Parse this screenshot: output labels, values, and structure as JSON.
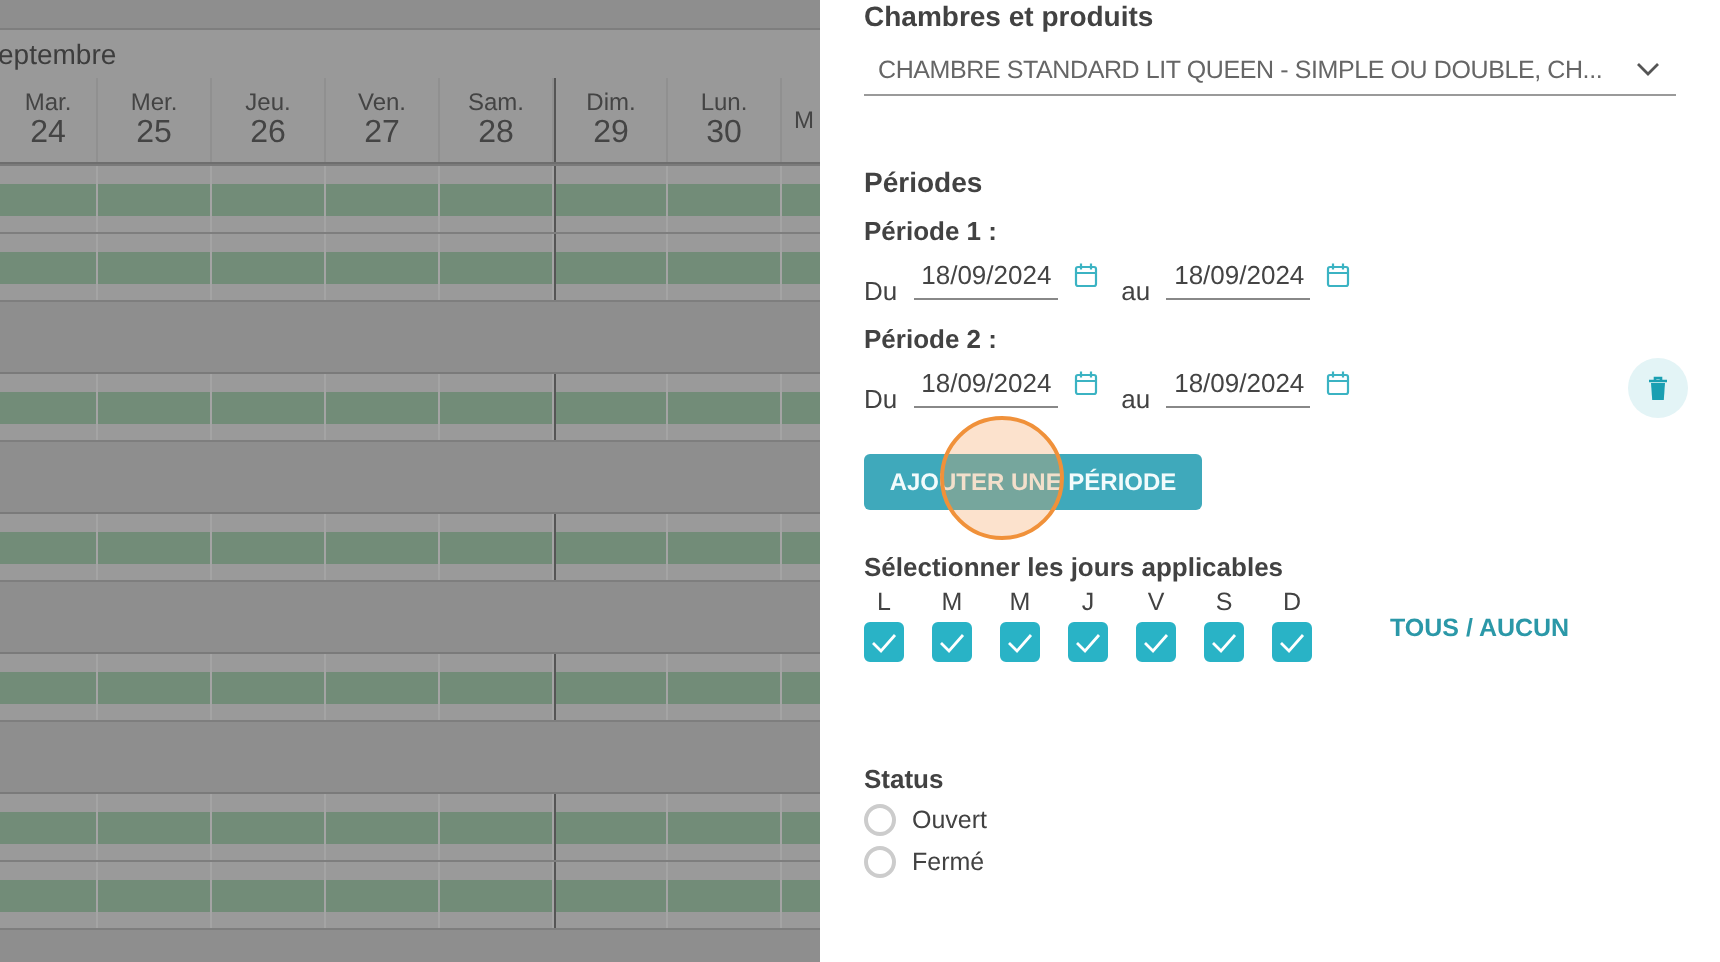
{
  "calendar": {
    "month": "eptembre",
    "days": [
      {
        "dow": "Mar.",
        "date": "24",
        "week_start": false
      },
      {
        "dow": "Mer.",
        "date": "25",
        "week_start": false
      },
      {
        "dow": "Jeu.",
        "date": "26",
        "week_start": false
      },
      {
        "dow": "Ven.",
        "date": "27",
        "week_start": false
      },
      {
        "dow": "Sam.",
        "date": "28",
        "week_start": false
      },
      {
        "dow": "Dim.",
        "date": "29",
        "week_start": true
      },
      {
        "dow": "Lun.",
        "date": "30",
        "week_start": false
      },
      {
        "dow": "M",
        "week_start": false
      }
    ],
    "groups": [
      {
        "rows": [
          {
            "kind": "available"
          },
          {
            "kind": "available"
          }
        ]
      },
      {
        "rows": [
          {
            "kind": "available"
          }
        ]
      },
      {
        "rows": [
          {
            "kind": "available"
          }
        ]
      },
      {
        "rows": [
          {
            "kind": "available"
          }
        ]
      },
      {
        "rows": [
          {
            "kind": "available"
          },
          {
            "kind": "available"
          }
        ]
      }
    ]
  },
  "form": {
    "rooms_label": "Chambres et produits",
    "rooms_value": "CHAMBRE STANDARD LIT QUEEN - SIMPLE OU DOUBLE, CH...",
    "periods_title": "Périodes",
    "periods": [
      {
        "label": "Période 1 :",
        "from_label": "Du",
        "from": "18/09/2024",
        "to_label": "au",
        "to": "18/09/2024",
        "deletable": false
      },
      {
        "label": "Période 2 :",
        "from_label": "Du",
        "from": "18/09/2024",
        "to_label": "au",
        "to": "18/09/2024",
        "deletable": true
      }
    ],
    "add_button": "AJOUTER UNE PÉRIODE",
    "days_label": "Sélectionner les jours applicables",
    "days": [
      {
        "letter": "L",
        "checked": true
      },
      {
        "letter": "M",
        "checked": true
      },
      {
        "letter": "M",
        "checked": true
      },
      {
        "letter": "J",
        "checked": true
      },
      {
        "letter": "V",
        "checked": true
      },
      {
        "letter": "S",
        "checked": true
      },
      {
        "letter": "D",
        "checked": true
      }
    ],
    "toggle_all": "TOUS / AUCUN",
    "status_label": "Status",
    "status_options": [
      {
        "label": "Ouvert",
        "selected": false
      },
      {
        "label": "Fermé",
        "selected": false
      }
    ]
  }
}
